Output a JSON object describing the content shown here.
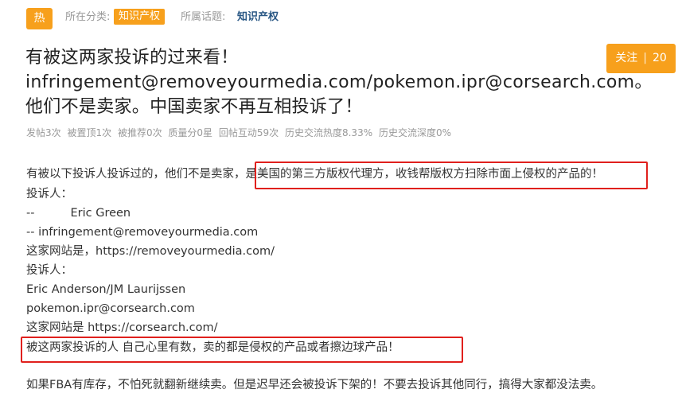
{
  "header": {
    "hot_badge": "热",
    "category_label": "所在分类:",
    "category_tag": "知识产权",
    "topic_label": "所属话题:",
    "topic_link": "知识产权"
  },
  "follow": {
    "label": "关注",
    "separator": "|",
    "count": "20"
  },
  "title": {
    "line1": "有被这两家投诉的过来看！",
    "line2": "infringement@removeyourmedia.com/pokemon.ipr@corsearch.com。",
    "line3": "他们不是卖家。中国卖家不再互相投诉了！"
  },
  "stats": [
    "发帖3次",
    "被置顶1次",
    "被推荐0次",
    "质量分0星",
    "回帖互动59次",
    "历史交流热度8.33%",
    "历史交流深度0%"
  ],
  "body": {
    "line1_a": "有被以下投诉人投诉过的，他们不是卖家，",
    "line1_b": "是美国的第三方版权代理方，收钱帮版权方扫除市面上侵权的产品的！",
    "line2": "投诉人：",
    "line3_prefix": "--",
    "line3_name": "Eric Green",
    "line4": "-- infringement@removeyourmedia.com",
    "line5": "这家网站是，https://removeyourmedia.com/",
    "line6": "投诉人：",
    "line7": "Eric Anderson/JM Laurijssen",
    "line8": "pokemon.ipr@corsearch.com",
    "line9": "这家网站是 https://corsearch.com/",
    "line10": "被这两家投诉的人  自己心里有数，卖的都是侵权的产品或者擦边球产品！",
    "line11": "如果FBA有库存，不怕死就翻新继续卖。但是迟早还会被投诉下架的！不要去投诉其他同行，搞得大家都没法卖。"
  },
  "colors": {
    "accent": "#f7a01c",
    "highlight_box": "#e0201d",
    "topic_link": "#2a5885"
  }
}
